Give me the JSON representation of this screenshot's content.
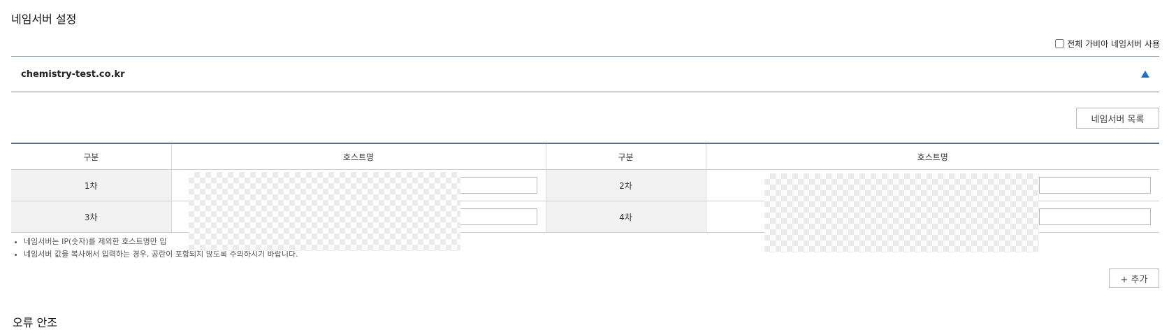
{
  "page": {
    "title": "네임서버 설정"
  },
  "options": {
    "all_gabia_label": "전체 가비아 네임서버 사용",
    "all_gabia_checked": false
  },
  "domain": {
    "name": "chemistry-test.co.kr"
  },
  "buttons": {
    "ns_list": "네임서버 목록",
    "add": "+ 추가"
  },
  "table": {
    "headers": [
      "구분",
      "호스트명",
      "구분",
      "호스트명"
    ],
    "rows": [
      {
        "left_label": "1차",
        "left_host": "",
        "right_label": "2차",
        "right_host": ""
      },
      {
        "left_label": "3차",
        "left_host": "",
        "right_label": "4차",
        "right_host": ""
      }
    ]
  },
  "notes": [
    "네임서버는 IP(숫자)를 제외한 호스트명만 입",
    "네임서버 값을 복사해서 입력하는 경우, 공란이 포함되지 않도록 주의하시기 바랍니다."
  ],
  "next_section": {
    "title": "오류 안조"
  }
}
